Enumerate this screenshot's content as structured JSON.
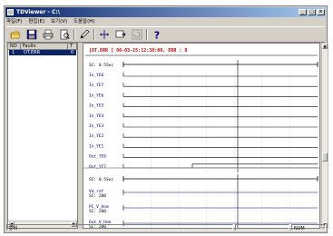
{
  "window": {
    "title": "TDViewer - C:\\",
    "minimize_glyph": "_",
    "maximize_glyph": "□",
    "close_glyph": "×"
  },
  "menu": [
    "파일(F)",
    "편집(E)",
    "보기(V)",
    "도움말(H)"
  ],
  "toolbar": {
    "buttons": [
      "open-folder-icon",
      "save-icon",
      "print-icon",
      "print-preview-icon",
      "pen-icon",
      "cursor-mode-icon",
      "zoom-icon",
      "reset-icon",
      "help-icon"
    ],
    "help_glyph": "?"
  },
  "fault_list": {
    "columns": [
      "NO",
      "Faults",
      "T"
    ],
    "rows": [
      {
        "no": "1",
        "fault": "OT.ERR",
        "t": "0"
      }
    ]
  },
  "trace": {
    "header": "[OT.ERR    ] 06-03-25:12:38:00, ERR : 0",
    "top_panel": {
      "time_scale": "SC: 0.5Sec",
      "channels": [
        "In_YE6",
        "In_YE7",
        "In_YE6",
        "In_YE5",
        "In_YE4",
        "In_YE3",
        "In_YE2",
        "In_YE1",
        "Out_YE6",
        "Out_YE7"
      ]
    },
    "bottom_panel": {
      "time_scale": "SC: 0.5Sec",
      "channels": [
        {
          "name": "Vm_ref",
          "scale": "SC: 200"
        },
        {
          "name": "PC_V_Hom",
          "scale": "SC: 200"
        },
        {
          "name": "Out_V_Hom",
          "scale": "SC: 200"
        }
      ]
    }
  },
  "status": {
    "left": "준비",
    "right": "NUM"
  },
  "colors": {
    "accent": "#0a246a",
    "header_text": "#cc0000",
    "trace_line": "#000080"
  }
}
